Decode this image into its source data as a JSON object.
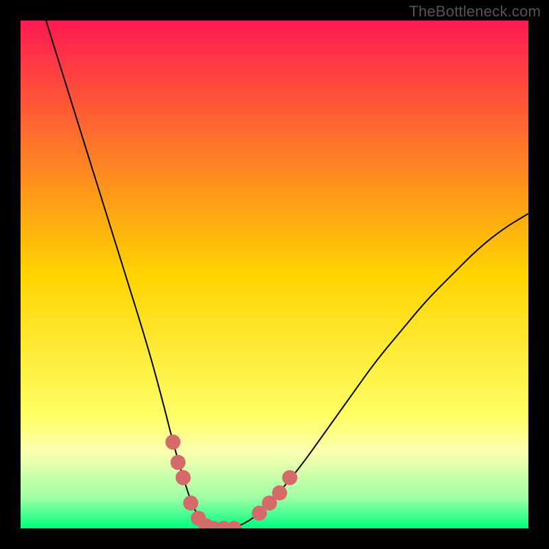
{
  "watermark": "TheBottleneck.com",
  "chart_data": {
    "type": "line",
    "title": "",
    "xlabel": "",
    "ylabel": "",
    "xlim": [
      0,
      100
    ],
    "ylim": [
      0,
      100
    ],
    "grid": false,
    "legend": false,
    "background_gradient": {
      "stops": [
        {
          "offset": 0.0,
          "color": "#ff1a52"
        },
        {
          "offset": 0.5,
          "color": "#ffd400"
        },
        {
          "offset": 0.78,
          "color": "#ffff66"
        },
        {
          "offset": 0.85,
          "color": "#fbffb0"
        },
        {
          "offset": 0.94,
          "color": "#9effa5"
        },
        {
          "offset": 1.0,
          "color": "#00ff80"
        }
      ]
    },
    "series": [
      {
        "name": "bottleneck-curve",
        "x": [
          5,
          10,
          15,
          20,
          25,
          28,
          30,
          32,
          34,
          36,
          38,
          40,
          42,
          46,
          50,
          55,
          60,
          65,
          70,
          75,
          80,
          85,
          90,
          95,
          100
        ],
        "y": [
          100,
          84,
          68,
          52,
          36,
          25,
          17,
          10,
          4,
          1,
          0,
          0,
          0,
          2,
          6,
          12,
          19,
          26,
          33,
          39,
          45,
          50,
          55,
          59,
          62
        ]
      }
    ],
    "markers": [
      {
        "name": "left-cluster",
        "color": "#d46a6a",
        "points": [
          {
            "x": 30,
            "y": 17
          },
          {
            "x": 31,
            "y": 13
          },
          {
            "x": 32,
            "y": 10
          },
          {
            "x": 33.5,
            "y": 5
          },
          {
            "x": 35,
            "y": 2
          },
          {
            "x": 36.5,
            "y": 0.5
          },
          {
            "x": 38,
            "y": 0
          },
          {
            "x": 40,
            "y": 0
          },
          {
            "x": 42,
            "y": 0
          }
        ]
      },
      {
        "name": "right-cluster",
        "color": "#d46a6a",
        "points": [
          {
            "x": 47,
            "y": 3
          },
          {
            "x": 49,
            "y": 5
          },
          {
            "x": 51,
            "y": 7
          },
          {
            "x": 53,
            "y": 10
          }
        ]
      }
    ]
  }
}
